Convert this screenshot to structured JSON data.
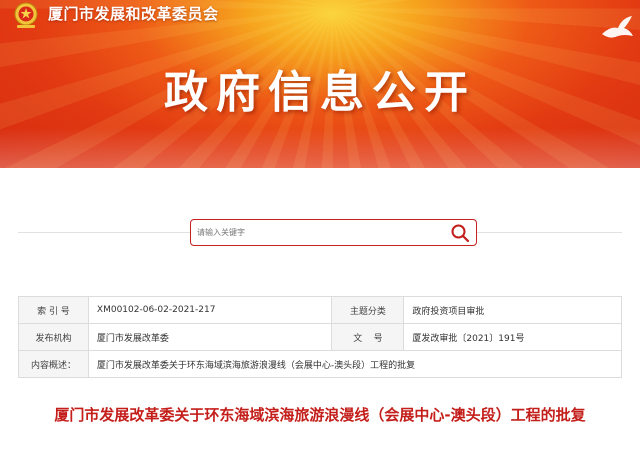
{
  "header": {
    "org_name": "厦门市发展和改革委员会",
    "main_title": "政府信息公开"
  },
  "search": {
    "placeholder": "请输入关键字"
  },
  "info": {
    "index_label": "索 引 号",
    "index_value": "XM00102-06-02-2021-217",
    "category_label": "主题分类",
    "category_value": "政府投资项目审批",
    "publisher_label": "发布机构",
    "publisher_value": "厦门市发展改革委",
    "docno_label": "文    号",
    "docno_value": "厦发改审批〔2021〕191号",
    "summary_label": "内容概述：",
    "summary_value": "厦门市发展改革委关于环东海域滨海旅游浪漫线（会展中心-澳头段）工程的批复"
  },
  "document": {
    "title": "厦门市发展改革委关于环东海域滨海旅游浪漫线（会展中心-澳头段）工程的批复"
  },
  "colors": {
    "accent_red": "#c41e1a",
    "banner_orange": "#ee5a16"
  }
}
